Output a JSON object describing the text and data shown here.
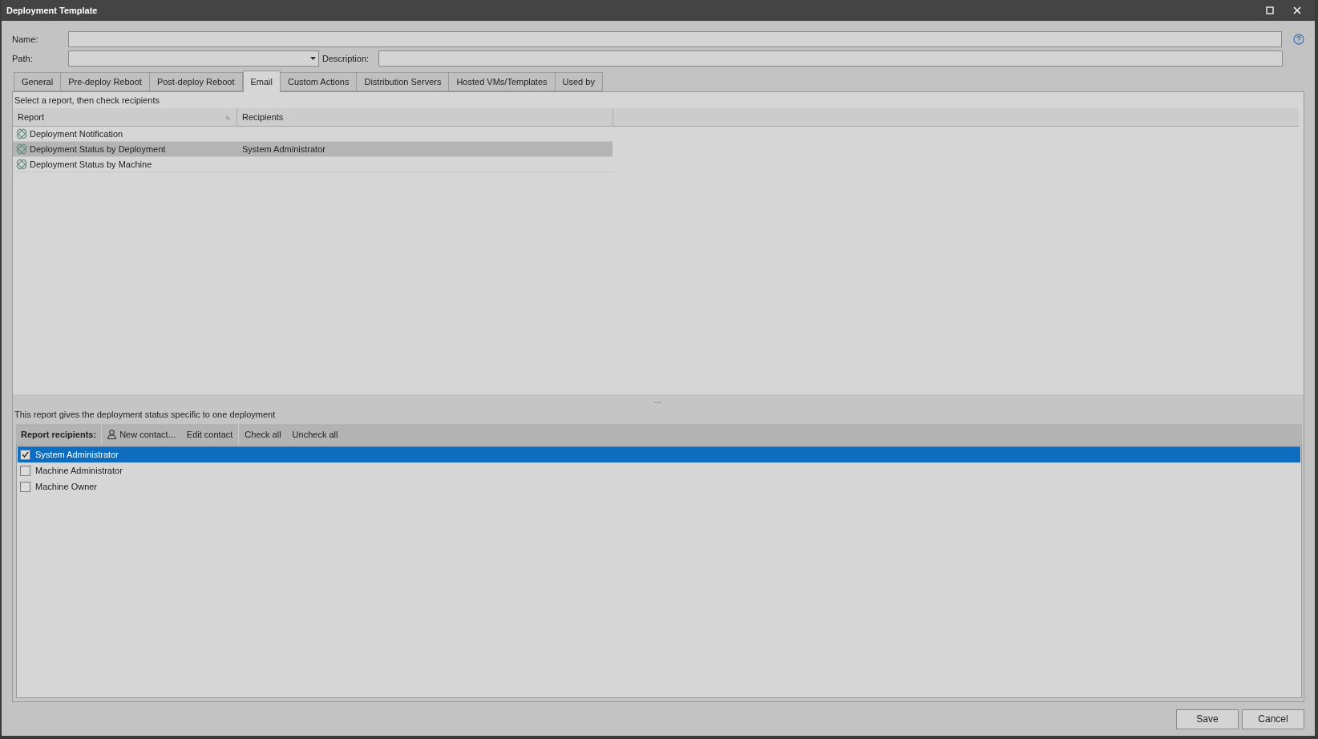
{
  "window": {
    "title": "Deployment Template"
  },
  "form": {
    "name_label": "Name:",
    "path_label": "Path:",
    "description_label": "Description:"
  },
  "tabs": [
    {
      "label": "General",
      "selected": false
    },
    {
      "label": "Pre-deploy Reboot",
      "selected": false
    },
    {
      "label": "Post-deploy Reboot",
      "selected": false
    },
    {
      "label": "Email",
      "selected": true
    },
    {
      "label": "Custom Actions",
      "selected": false
    },
    {
      "label": "Distribution Servers",
      "selected": false
    },
    {
      "label": "Hosted VMs/Templates",
      "selected": false
    },
    {
      "label": "Used by",
      "selected": false
    }
  ],
  "instruction": "Select a report, then check recipients",
  "table": {
    "columns": [
      "Report",
      "Recipients"
    ],
    "rows": [
      {
        "report": "Deployment Notification",
        "selected": false
      },
      {
        "report": "Deployment Status by Deployment",
        "recipients": "System Administrator",
        "selected": true
      },
      {
        "report": "Deployment Status by Machine",
        "selected": false
      }
    ]
  },
  "splitter": "...",
  "report_description": "This report gives the deployment status specific to one deployment",
  "toolbar": {
    "label": "Report recipients:",
    "buttons": [
      {
        "kind": "contact",
        "label": "New contact..."
      },
      {
        "kind": "plain",
        "label": "Edit contact"
      },
      {
        "kind": "plain",
        "label": "Check all"
      },
      {
        "kind": "plain",
        "label": "Uncheck all"
      }
    ]
  },
  "recipients": [
    {
      "label": "System Administrator",
      "checked": true,
      "selected": true
    },
    {
      "label": "Machine Administrator",
      "checked": false,
      "selected": false
    },
    {
      "label": "Machine Owner",
      "checked": false,
      "selected": false
    }
  ],
  "buttons": [
    "Save",
    "Cancel"
  ]
}
